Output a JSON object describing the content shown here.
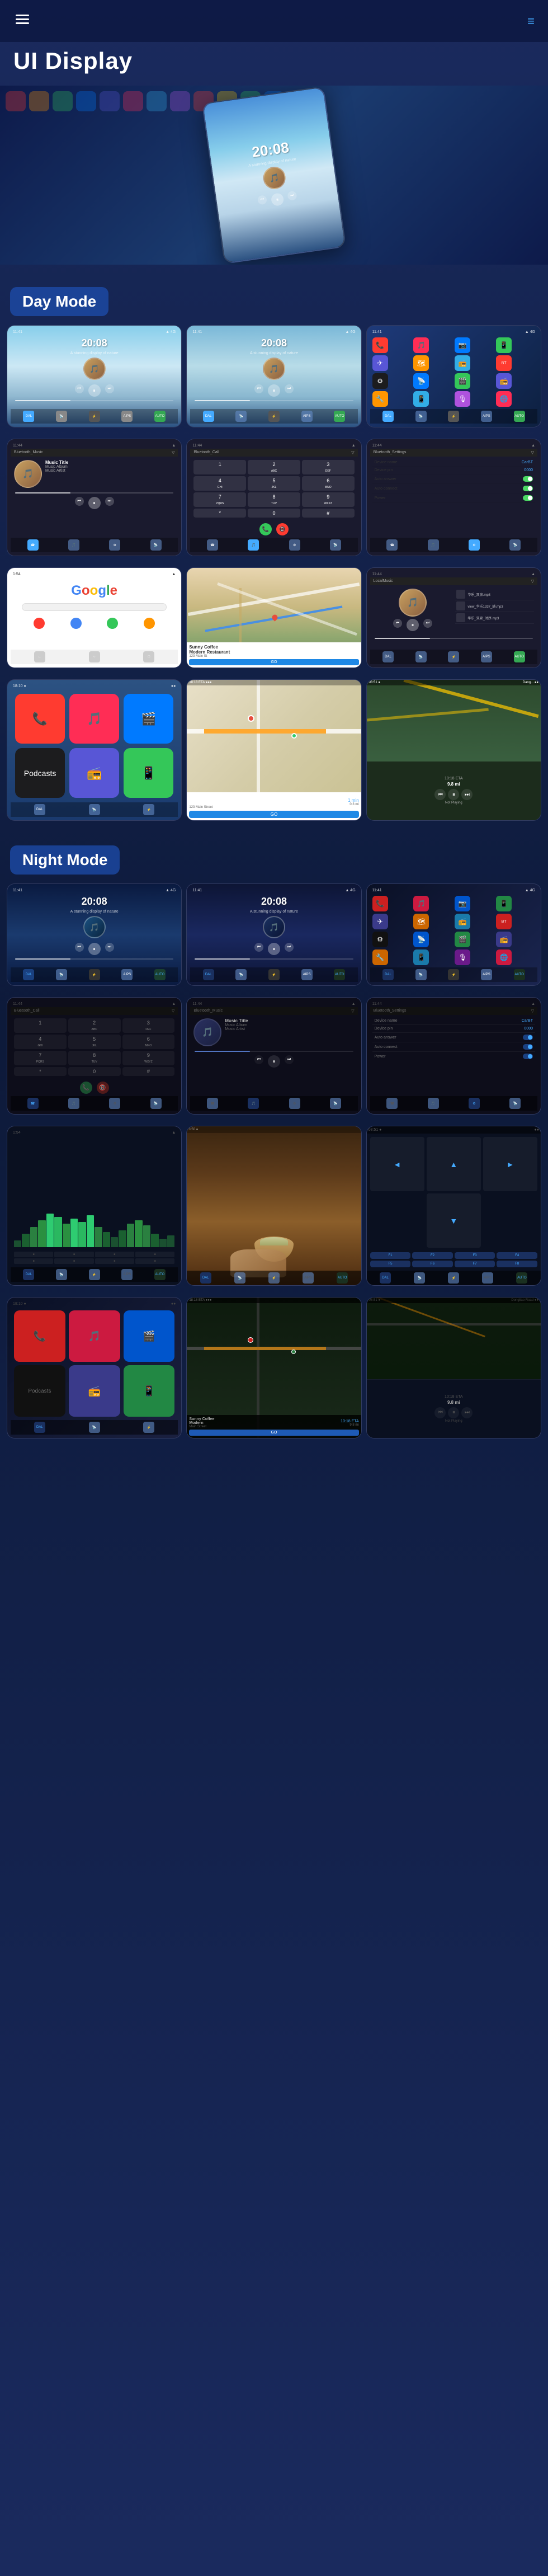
{
  "header": {
    "menu_label": "≡",
    "nav_label": "≡",
    "page_title": "UI Display",
    "hamburger_icon": "☰",
    "lines_icon": "≡"
  },
  "sections": {
    "day_mode": "Day Mode",
    "night_mode": "Night Mode"
  },
  "day_mode_screens": [
    {
      "id": "day-music-1",
      "type": "music-player",
      "time": "20:08",
      "subtitle": "A stunning display of nature",
      "bg": "day"
    },
    {
      "id": "day-music-2",
      "type": "music-player",
      "time": "20:08",
      "subtitle": "A stunning display of nature",
      "bg": "day-alt"
    },
    {
      "id": "day-apps",
      "type": "app-grid",
      "bg": "day"
    },
    {
      "id": "day-bluetooth-music",
      "type": "bluetooth-music",
      "header": "Bluetooth_Music",
      "track_title": "Music Title",
      "track_album": "Music Album",
      "track_artist": "Music Artist"
    },
    {
      "id": "day-phone",
      "type": "phone",
      "header": "Bluetooth_Call"
    },
    {
      "id": "day-settings",
      "type": "settings",
      "header": "Bluetooth_Settings",
      "fields": [
        {
          "label": "Device name",
          "value": "CarBT"
        },
        {
          "label": "Device pin",
          "value": "0000"
        },
        {
          "label": "Auto answer",
          "value": "toggle-on"
        },
        {
          "label": "Auto connect",
          "value": "toggle-on"
        },
        {
          "label": "Power",
          "value": "toggle-on"
        }
      ]
    },
    {
      "id": "day-google",
      "type": "google"
    },
    {
      "id": "day-map",
      "type": "map"
    },
    {
      "id": "day-local-music",
      "type": "local-music",
      "header": "LocalMusic",
      "tracks": [
        "华乐_双泉.mp3",
        "view_华乐1337_蜷.mp3",
        "华乐_双泉_时序.mp3"
      ]
    }
  ],
  "day_mode_row2": [
    {
      "id": "day-carplay",
      "type": "carplay-apps"
    },
    {
      "id": "day-nav",
      "type": "navigation-map"
    },
    {
      "id": "day-nav-turn",
      "type": "navigation-turn",
      "eta": "10:18 ETA",
      "distance": "9.8 mi"
    }
  ],
  "night_mode_screens": [
    {
      "id": "night-music-1",
      "type": "music-player-night",
      "time": "20:08",
      "subtitle": "A stunning display of nature"
    },
    {
      "id": "night-music-2",
      "type": "music-player-night",
      "time": "20:08",
      "subtitle": "A stunning display of nature"
    },
    {
      "id": "night-apps",
      "type": "app-grid-night"
    },
    {
      "id": "night-phone",
      "type": "phone-night",
      "header": "Bluetooth_Call"
    },
    {
      "id": "night-bluetooth-music",
      "type": "bluetooth-music-night",
      "header": "Bluetooth_Music",
      "track_title": "Music Title",
      "track_album": "Music Album",
      "track_artist": "Music Artist"
    },
    {
      "id": "night-settings",
      "type": "settings-night",
      "header": "Bluetooth_Settings"
    }
  ],
  "night_mode_row2": [
    {
      "id": "night-waveform",
      "type": "waveform-night"
    },
    {
      "id": "night-food",
      "type": "food-screen"
    },
    {
      "id": "night-nav-grid",
      "type": "nav-grid-night"
    }
  ],
  "night_mode_row3": [
    {
      "id": "night-carplay",
      "type": "carplay-night"
    },
    {
      "id": "night-nav-map",
      "type": "nav-map-night"
    },
    {
      "id": "night-nav-turn",
      "type": "nav-turn-night",
      "eta": "10:18 ETA",
      "distance": "9.8 mi"
    }
  ],
  "app_icons": [
    {
      "color": "#ff3b30",
      "symbol": "📞"
    },
    {
      "color": "#ff2d55",
      "symbol": "🎵"
    },
    {
      "color": "#007aff",
      "symbol": "📷"
    },
    {
      "color": "#34c759",
      "symbol": "📱"
    },
    {
      "color": "#5856d6",
      "symbol": "✈"
    },
    {
      "color": "#ff9500",
      "symbol": "🗺"
    },
    {
      "color": "#32ade6",
      "symbol": "📻"
    },
    {
      "color": "#ff3b30",
      "symbol": "BT"
    },
    {
      "color": "#1c1c1e",
      "symbol": "⚙"
    },
    {
      "color": "#007aff",
      "symbol": "📡"
    },
    {
      "color": "#34c759",
      "symbol": "🎬"
    },
    {
      "color": "#5856d6",
      "symbol": "📻"
    }
  ]
}
